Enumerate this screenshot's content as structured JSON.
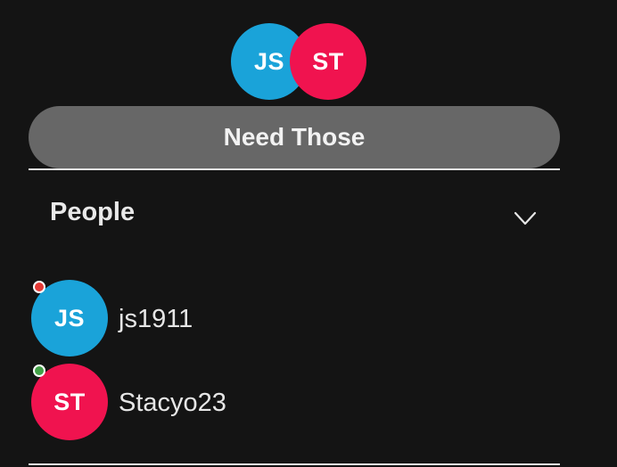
{
  "header": {
    "avatars": [
      {
        "initials": "JS",
        "color": "#1aa3d9"
      },
      {
        "initials": "ST",
        "color": "#f0134f"
      }
    ],
    "title": "Need Those"
  },
  "people_section": {
    "title": "People",
    "expand_icon": "chevron-down-icon",
    "members": [
      {
        "initials": "JS",
        "name": "js1911",
        "avatar_color": "#1aa3d9",
        "status": "offline",
        "status_color": "#e53935"
      },
      {
        "initials": "ST",
        "name": "Stacyo23",
        "avatar_color": "#f0134f",
        "status": "online",
        "status_color": "#43a047"
      }
    ]
  }
}
